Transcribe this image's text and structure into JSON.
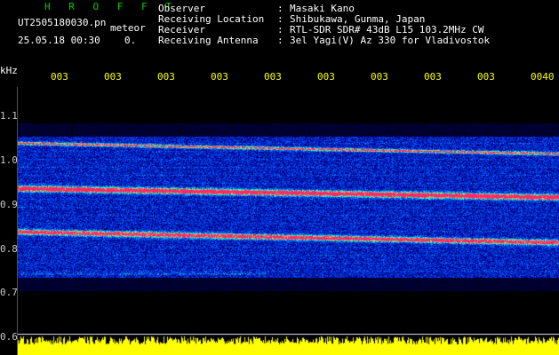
{
  "header": {
    "app_name": "H R O F F T",
    "filename": "UT2505180030.pn",
    "meteor_label": "meteor",
    "datetime": "25.05.18 00:30",
    "value": "0.",
    "fields": [
      {
        "label": "Observer",
        "value": "Masaki Kano"
      },
      {
        "label": "Receiving Location",
        "value": "Shibukawa, Gunma, Japan"
      },
      {
        "label": "Receiver",
        "value": "RTL-SDR SDR# 43dB L15 103.2MHz CW"
      },
      {
        "label": "Receiving Antenna",
        "value": "3el Yagi(V) Az 330 for Vladivostok"
      }
    ]
  },
  "axis": {
    "unit": "kHz",
    "y_ticks": [
      "1.1",
      "1.0",
      "0.9",
      "0.8",
      "0.7",
      "0.6"
    ],
    "x_ticks": [
      "003",
      "003",
      "003",
      "003",
      "003",
      "003",
      "003",
      "003",
      "003",
      "0040"
    ]
  },
  "colors": {
    "background": "#000000",
    "header_title": "#00d000",
    "tick_labels": "#ffff00",
    "signal_strong": "#ff2060",
    "strip": "#ffff00"
  }
}
